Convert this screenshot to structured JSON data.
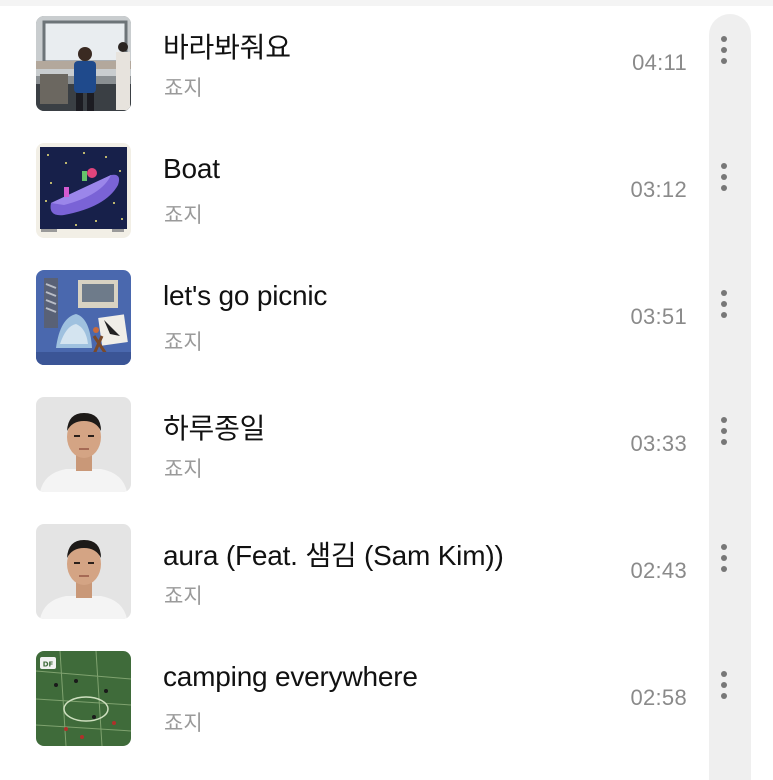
{
  "tracks": [
    {
      "title": "바라봐줘요",
      "artist": "죠지",
      "duration": "04:11",
      "art": "subway-photo"
    },
    {
      "title": "Boat",
      "artist": "죠지",
      "duration": "03:12",
      "art": "boat-illustration"
    },
    {
      "title": "let's go picnic",
      "artist": "죠지",
      "duration": "03:51",
      "art": "picnic-collage"
    },
    {
      "title": "하루종일",
      "artist": "죠지",
      "duration": "03:33",
      "art": "portrait"
    },
    {
      "title": "aura (Feat. 샘김 (Sam Kim))",
      "artist": "죠지",
      "duration": "02:43",
      "art": "portrait"
    },
    {
      "title": "camping everywhere",
      "artist": "죠지",
      "duration": "02:58",
      "art": "camping-field",
      "art_badge": "DF"
    }
  ],
  "icons": {
    "more": "more-vertical-icon"
  },
  "colors": {
    "title": "#111111",
    "artist": "#9a9a9a",
    "duration": "#8a8a8a",
    "more_dots": "#777777",
    "scroll_track": "#efefef"
  }
}
